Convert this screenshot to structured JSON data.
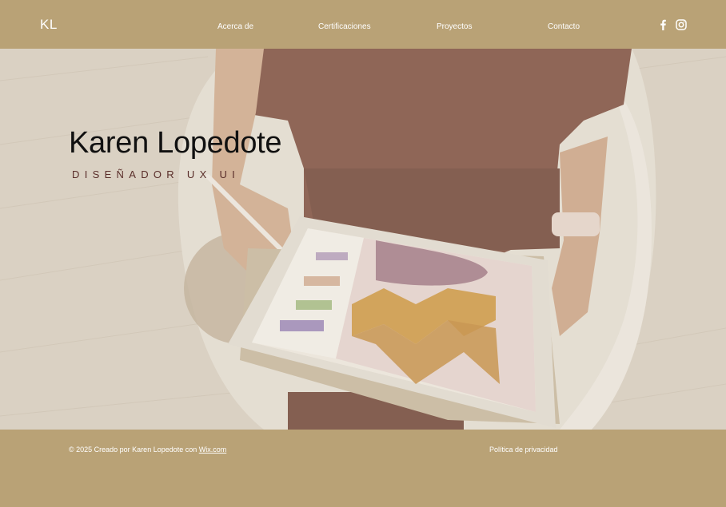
{
  "header": {
    "logo": "KL",
    "nav": [
      "Acerca de",
      "Certificaciones",
      "Proyectos",
      "Contacto"
    ],
    "social": [
      "facebook-icon",
      "instagram-icon"
    ]
  },
  "hero": {
    "title": "Karen Lopedote",
    "subtitle": "DISEÑADOR UX UI"
  },
  "footer": {
    "copyright_prefix": "© 2025 Creado por Karen Lopedote con ",
    "copyright_link": "Wix.com",
    "privacy": "Política de privacidad"
  },
  "colors": {
    "brand": "#b9a276",
    "text_light": "#ffffff",
    "title": "#111111",
    "subtitle": "#5a2e2a"
  }
}
